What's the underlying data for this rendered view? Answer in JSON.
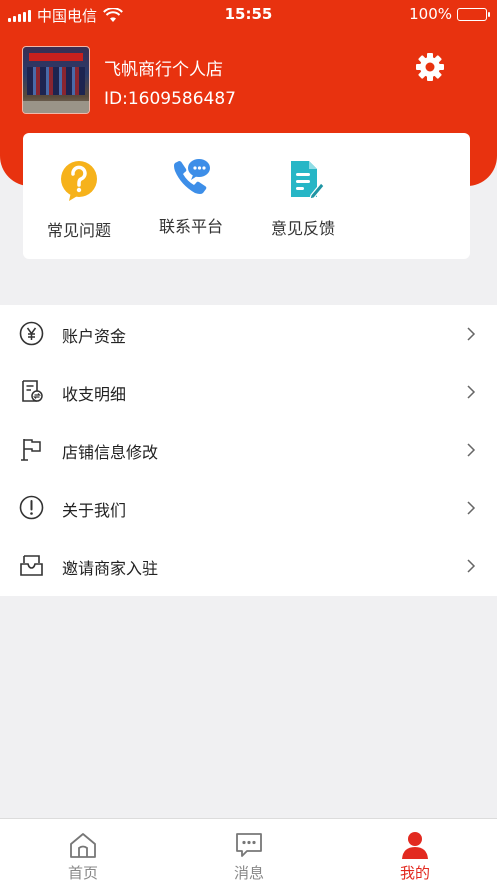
{
  "status_bar": {
    "carrier": "中国电信",
    "time": "15:55",
    "battery_percent": "100%",
    "battery_level": 1.0
  },
  "profile": {
    "shop_name": "飞帆商行个人店",
    "shop_id": "ID:1609586487",
    "avatar_icon": "shop-photo"
  },
  "quick_actions": [
    {
      "label": "常见问题",
      "icon": "question-bubble-icon",
      "color": "#f6b21b"
    },
    {
      "label": "联系平台",
      "icon": "phone-chat-icon",
      "color": "#3d8ee8"
    },
    {
      "label": "意见反馈",
      "icon": "feedback-doc-icon",
      "color": "#27b6c6"
    }
  ],
  "menu": [
    {
      "label": "账户资金",
      "icon": "yen-circle-icon"
    },
    {
      "label": "收支明细",
      "icon": "bill-exchange-icon"
    },
    {
      "label": "店铺信息修改",
      "icon": "flag-icon"
    },
    {
      "label": "关于我们",
      "icon": "info-exclamation-icon"
    },
    {
      "label": "邀请商家入驻",
      "icon": "inbox-icon"
    }
  ],
  "tabbar": [
    {
      "label": "首页",
      "icon": "home-icon"
    },
    {
      "label": "消息",
      "icon": "message-icon"
    },
    {
      "label": "我的",
      "icon": "person-icon",
      "active": true
    }
  ],
  "colors": {
    "header": "#e8320f",
    "accent": "#e22a20",
    "battery": "#4cd964"
  }
}
